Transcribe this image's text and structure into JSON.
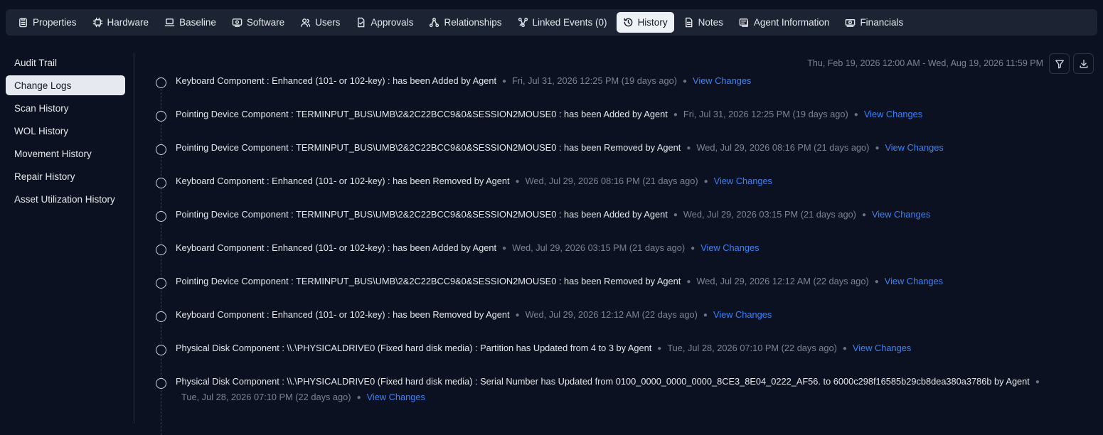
{
  "tabs": [
    {
      "label": "Properties",
      "icon": "clipboard-icon",
      "active": false
    },
    {
      "label": "Hardware",
      "icon": "chip-icon",
      "active": false
    },
    {
      "label": "Baseline",
      "icon": "laptop-icon",
      "active": false
    },
    {
      "label": "Software",
      "icon": "software-icon",
      "active": false
    },
    {
      "label": "Users",
      "icon": "users-icon",
      "active": false
    },
    {
      "label": "Approvals",
      "icon": "approval-icon",
      "active": false
    },
    {
      "label": "Relationships",
      "icon": "relationships-icon",
      "active": false
    },
    {
      "label": "Linked Events (0)",
      "icon": "linked-events-icon",
      "active": false
    },
    {
      "label": "History",
      "icon": "history-icon",
      "active": true
    },
    {
      "label": "Notes",
      "icon": "notes-icon",
      "active": false
    },
    {
      "label": "Agent Information",
      "icon": "agent-icon",
      "active": false
    },
    {
      "label": "Financials",
      "icon": "money-icon",
      "active": false
    }
  ],
  "sidebar": {
    "items": [
      {
        "label": "Audit Trail",
        "active": false
      },
      {
        "label": "Change Logs",
        "active": true
      },
      {
        "label": "Scan History",
        "active": false
      },
      {
        "label": "WOL History",
        "active": false
      },
      {
        "label": "Movement History",
        "active": false
      },
      {
        "label": "Repair History",
        "active": false
      },
      {
        "label": "Asset Utilization History",
        "active": false
      }
    ]
  },
  "header": {
    "date_range": "Thu, Feb 19, 2026 12:00 AM - Wed, Aug 19, 2026 11:59 PM",
    "filter_icon": "filter-icon",
    "download_icon": "download-icon"
  },
  "entries": [
    {
      "message": "Keyboard Component : Enhanced (101- or 102-key) : has been Added by Agent",
      "time": "Fri, Jul 31, 2026 12:25 PM (19 days ago)",
      "link": "View Changes"
    },
    {
      "message": "Pointing Device Component : TERMINPUT_BUS\\UMB\\2&2C22BCC9&0&SESSION2MOUSE0 : has been Added by Agent",
      "time": "Fri, Jul 31, 2026 12:25 PM (19 days ago)",
      "link": "View Changes"
    },
    {
      "message": "Pointing Device Component : TERMINPUT_BUS\\UMB\\2&2C22BCC9&0&SESSION2MOUSE0 : has been Removed by Agent",
      "time": "Wed, Jul 29, 2026 08:16 PM (21 days ago)",
      "link": "View Changes"
    },
    {
      "message": "Keyboard Component : Enhanced (101- or 102-key) : has been Removed by Agent",
      "time": "Wed, Jul 29, 2026 08:16 PM (21 days ago)",
      "link": "View Changes"
    },
    {
      "message": "Pointing Device Component : TERMINPUT_BUS\\UMB\\2&2C22BCC9&0&SESSION2MOUSE0 : has been Added by Agent",
      "time": "Wed, Jul 29, 2026 03:15 PM (21 days ago)",
      "link": "View Changes"
    },
    {
      "message": "Keyboard Component : Enhanced (101- or 102-key) : has been Added by Agent",
      "time": "Wed, Jul 29, 2026 03:15 PM (21 days ago)",
      "link": "View Changes"
    },
    {
      "message": "Pointing Device Component : TERMINPUT_BUS\\UMB\\2&2C22BCC9&0&SESSION2MOUSE0 : has been Removed by Agent",
      "time": "Wed, Jul 29, 2026 12:12 AM (22 days ago)",
      "link": "View Changes"
    },
    {
      "message": "Keyboard Component : Enhanced (101- or 102-key) : has been Removed by Agent",
      "time": "Wed, Jul 29, 2026 12:12 AM (22 days ago)",
      "link": "View Changes"
    },
    {
      "message": "Physical Disk Component : \\\\.\\PHYSICALDRIVE0 (Fixed hard disk media) : Partition has Updated from 4 to 3 by Agent",
      "time": "Tue, Jul 28, 2026 07:10 PM (22 days ago)",
      "link": "View Changes"
    },
    {
      "message": "Physical Disk Component : \\\\.\\PHYSICALDRIVE0 (Fixed hard disk media) : Serial Number has Updated from 0100_0000_0000_0000_8CE3_8E04_0222_AF56. to 6000c298f16585b29cb8dea380a3786b by Agent",
      "time": "Tue, Jul 28, 2026 07:10 PM (22 days ago)",
      "link": "View Changes"
    }
  ],
  "colors": {
    "background": "#0b1120",
    "tabbar": "#1c2433",
    "active_tab": "#eef1f6",
    "link": "#3b82f6",
    "muted_text": "#7b8496"
  }
}
